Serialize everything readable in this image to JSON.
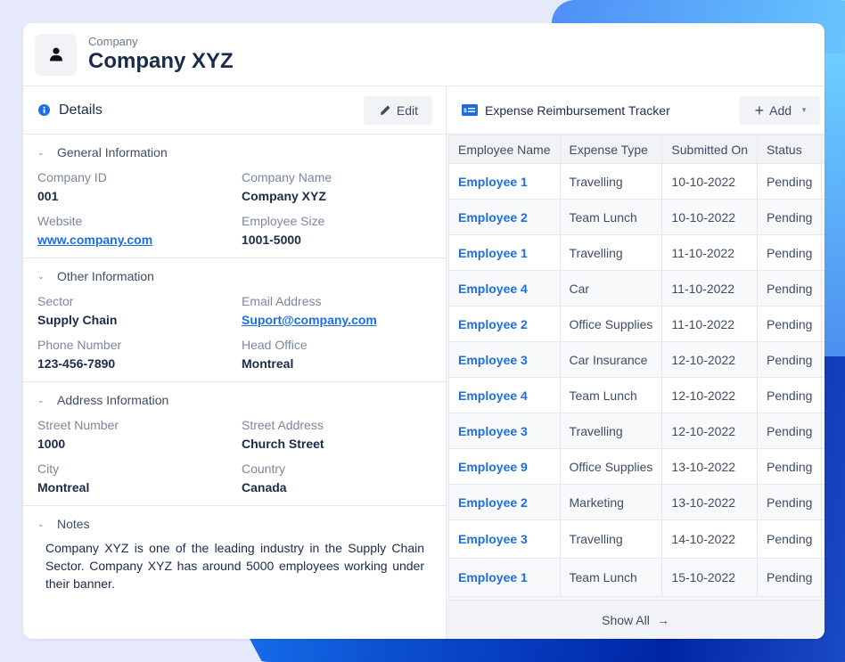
{
  "header": {
    "subtitle": "Company",
    "title": "Company XYZ",
    "icon": "user-icon"
  },
  "details": {
    "title": "Details",
    "edit_label": "Edit",
    "sections": [
      {
        "title": "General Information",
        "fields": [
          {
            "label": "Company ID",
            "value": "001"
          },
          {
            "label": "Company Name",
            "value": "Company XYZ"
          },
          {
            "label": "Website",
            "value": "www.company.com"
          },
          {
            "label": "Employee Size",
            "value": "1001-5000"
          }
        ]
      },
      {
        "title": "Other Information",
        "fields": [
          {
            "label": "Sector",
            "value": "Supply Chain"
          },
          {
            "label": "Email Address",
            "value": "Suport@company.com"
          },
          {
            "label": "Phone Number",
            "value": "123-456-7890"
          },
          {
            "label": "Head Office",
            "value": "Montreal"
          }
        ]
      },
      {
        "title": "Address Information",
        "fields": [
          {
            "label": "Street Number",
            "value": "1000"
          },
          {
            "label": "Street Address",
            "value": "Church Street"
          },
          {
            "label": "City",
            "value": "Montreal"
          },
          {
            "label": "Country",
            "value": "Canada"
          }
        ]
      }
    ],
    "notes": {
      "title": "Notes",
      "text": "Company XYZ is one of the leading industry in the Supply Chain Sector. Company XYZ has around 5000 employees working under their banner."
    }
  },
  "tracker": {
    "title": "Expense Reimbursement Tracker",
    "add_label": "Add",
    "columns": [
      "Employee Name",
      "Expense Type",
      "Submitted On",
      "Status"
    ],
    "rows": [
      [
        "Employee 1",
        "Travelling",
        "10-10-2022",
        "Pending"
      ],
      [
        "Employee 2",
        "Team Lunch",
        "10-10-2022",
        "Pending"
      ],
      [
        "Employee 1",
        "Travelling",
        "11-10-2022",
        "Pending"
      ],
      [
        "Employee 4",
        "Car",
        "11-10-2022",
        "Pending"
      ],
      [
        "Employee 2",
        "Office Supplies",
        "11-10-2022",
        "Pending"
      ],
      [
        "Employee 3",
        "Car Insurance",
        "12-10-2022",
        "Pending"
      ],
      [
        "Employee 4",
        "Team Lunch",
        "12-10-2022",
        "Pending"
      ],
      [
        "Employee 3",
        "Travelling",
        "12-10-2022",
        "Pending"
      ],
      [
        "Employee 9",
        "Office Supplies",
        "13-10-2022",
        "Pending"
      ],
      [
        "Employee 2",
        "Marketing",
        "13-10-2022",
        "Pending"
      ],
      [
        "Employee 3",
        "Travelling",
        "14-10-2022",
        "Pending"
      ],
      [
        "Employee 1",
        "Team Lunch",
        "15-10-2022",
        "Pending"
      ]
    ],
    "show_all_label": "Show All"
  },
  "colors": {
    "accent": "#1d6fe0",
    "title": "#1c2b4a",
    "muted": "#7c8799"
  }
}
